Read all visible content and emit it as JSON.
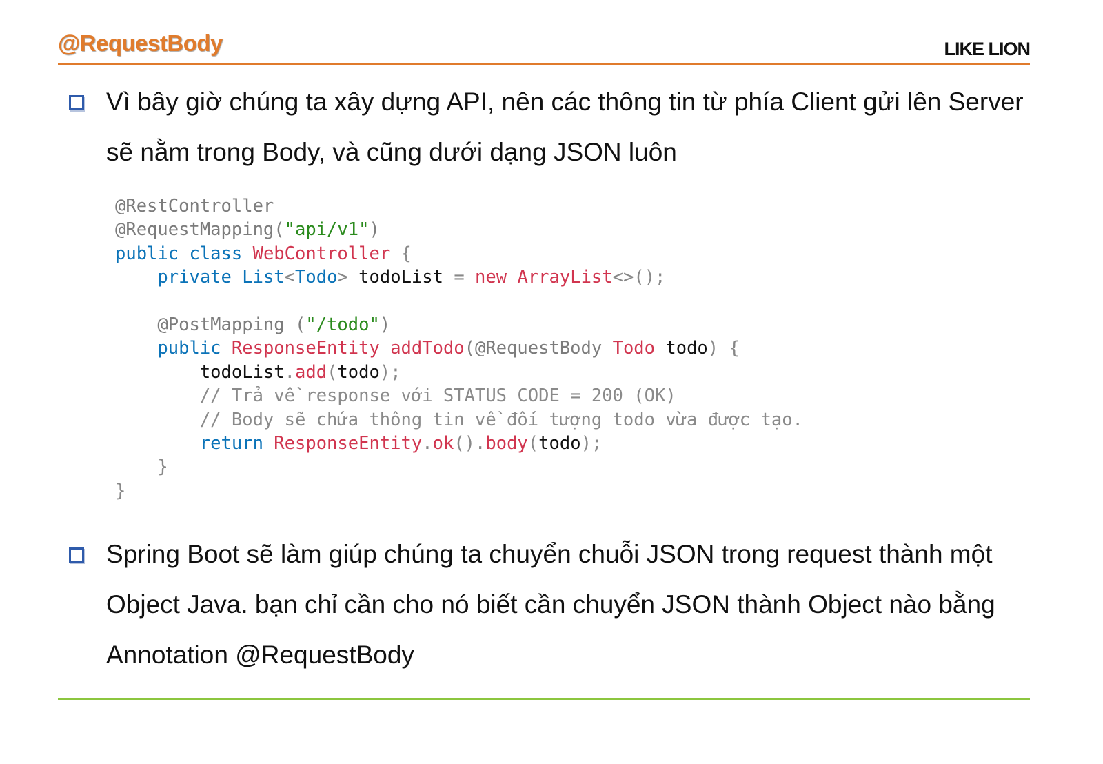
{
  "header": {
    "title": "@RequestBody",
    "brand": "LIKE LION"
  },
  "bullets": [
    "Vì bây giờ chúng ta xây dựng API, nên các thông tin từ phía Client gửi lên Server sẽ nằm trong Body, và cũng dưới dạng JSON luôn",
    "Spring Boot sẽ làm giúp chúng ta chuyển chuỗi JSON trong request thành một Object Java. bạn chỉ cần cho nó biết cần chuyển JSON thành Object nào bằng Annotation @RequestBody"
  ],
  "code": {
    "lines": [
      [
        {
          "t": "@RestController",
          "c": "an"
        }
      ],
      [
        {
          "t": "@RequestMapping(",
          "c": "an"
        },
        {
          "t": "\"api/v1\"",
          "c": "st"
        },
        {
          "t": ")",
          "c": "an"
        }
      ],
      [
        {
          "t": "public class ",
          "c": "kw"
        },
        {
          "t": "WebController",
          "c": "ty"
        },
        {
          "t": " {",
          "c": "pn"
        }
      ],
      [
        {
          "t": "    private ",
          "c": "kw"
        },
        {
          "t": "List",
          "c": "kw"
        },
        {
          "t": "<",
          "c": "pn"
        },
        {
          "t": "Todo",
          "c": "kw"
        },
        {
          "t": "> ",
          "c": "pn"
        },
        {
          "t": "todoList",
          "c": "id"
        },
        {
          "t": " = ",
          "c": "pn"
        },
        {
          "t": "new ",
          "c": "ty"
        },
        {
          "t": "ArrayList",
          "c": "ty"
        },
        {
          "t": "<>();",
          "c": "pn"
        }
      ],
      [
        {
          "t": "",
          "c": "pn"
        }
      ],
      [
        {
          "t": "    @PostMapping (",
          "c": "an"
        },
        {
          "t": "\"/todo\"",
          "c": "st"
        },
        {
          "t": ")",
          "c": "an"
        }
      ],
      [
        {
          "t": "    public ",
          "c": "kw"
        },
        {
          "t": "ResponseEntity ",
          "c": "ty"
        },
        {
          "t": "addTodo",
          "c": "ty"
        },
        {
          "t": "(@RequestBody ",
          "c": "an"
        },
        {
          "t": "Todo ",
          "c": "ty"
        },
        {
          "t": "todo",
          "c": "id"
        },
        {
          "t": ") {",
          "c": "pn"
        }
      ],
      [
        {
          "t": "        todoList",
          "c": "id"
        },
        {
          "t": ".",
          "c": "pn"
        },
        {
          "t": "add",
          "c": "ty"
        },
        {
          "t": "(",
          "c": "pn"
        },
        {
          "t": "todo",
          "c": "id"
        },
        {
          "t": ");",
          "c": "pn"
        }
      ],
      [
        {
          "t": "        // Trả về response với STATUS CODE = 200 (OK)",
          "c": "cm"
        }
      ],
      [
        {
          "t": "        // Body sẽ chứa thông tin về đối tượng todo vừa được tạo.",
          "c": "cm"
        }
      ],
      [
        {
          "t": "        return ",
          "c": "kw"
        },
        {
          "t": "ResponseEntity",
          "c": "ty"
        },
        {
          "t": ".",
          "c": "pn"
        },
        {
          "t": "ok",
          "c": "ty"
        },
        {
          "t": "().",
          "c": "pn"
        },
        {
          "t": "body",
          "c": "ty"
        },
        {
          "t": "(",
          "c": "pn"
        },
        {
          "t": "todo",
          "c": "id"
        },
        {
          "t": ");",
          "c": "pn"
        }
      ],
      [
        {
          "t": "    }",
          "c": "pn"
        }
      ],
      [
        {
          "t": "}",
          "c": "pn"
        }
      ]
    ]
  }
}
